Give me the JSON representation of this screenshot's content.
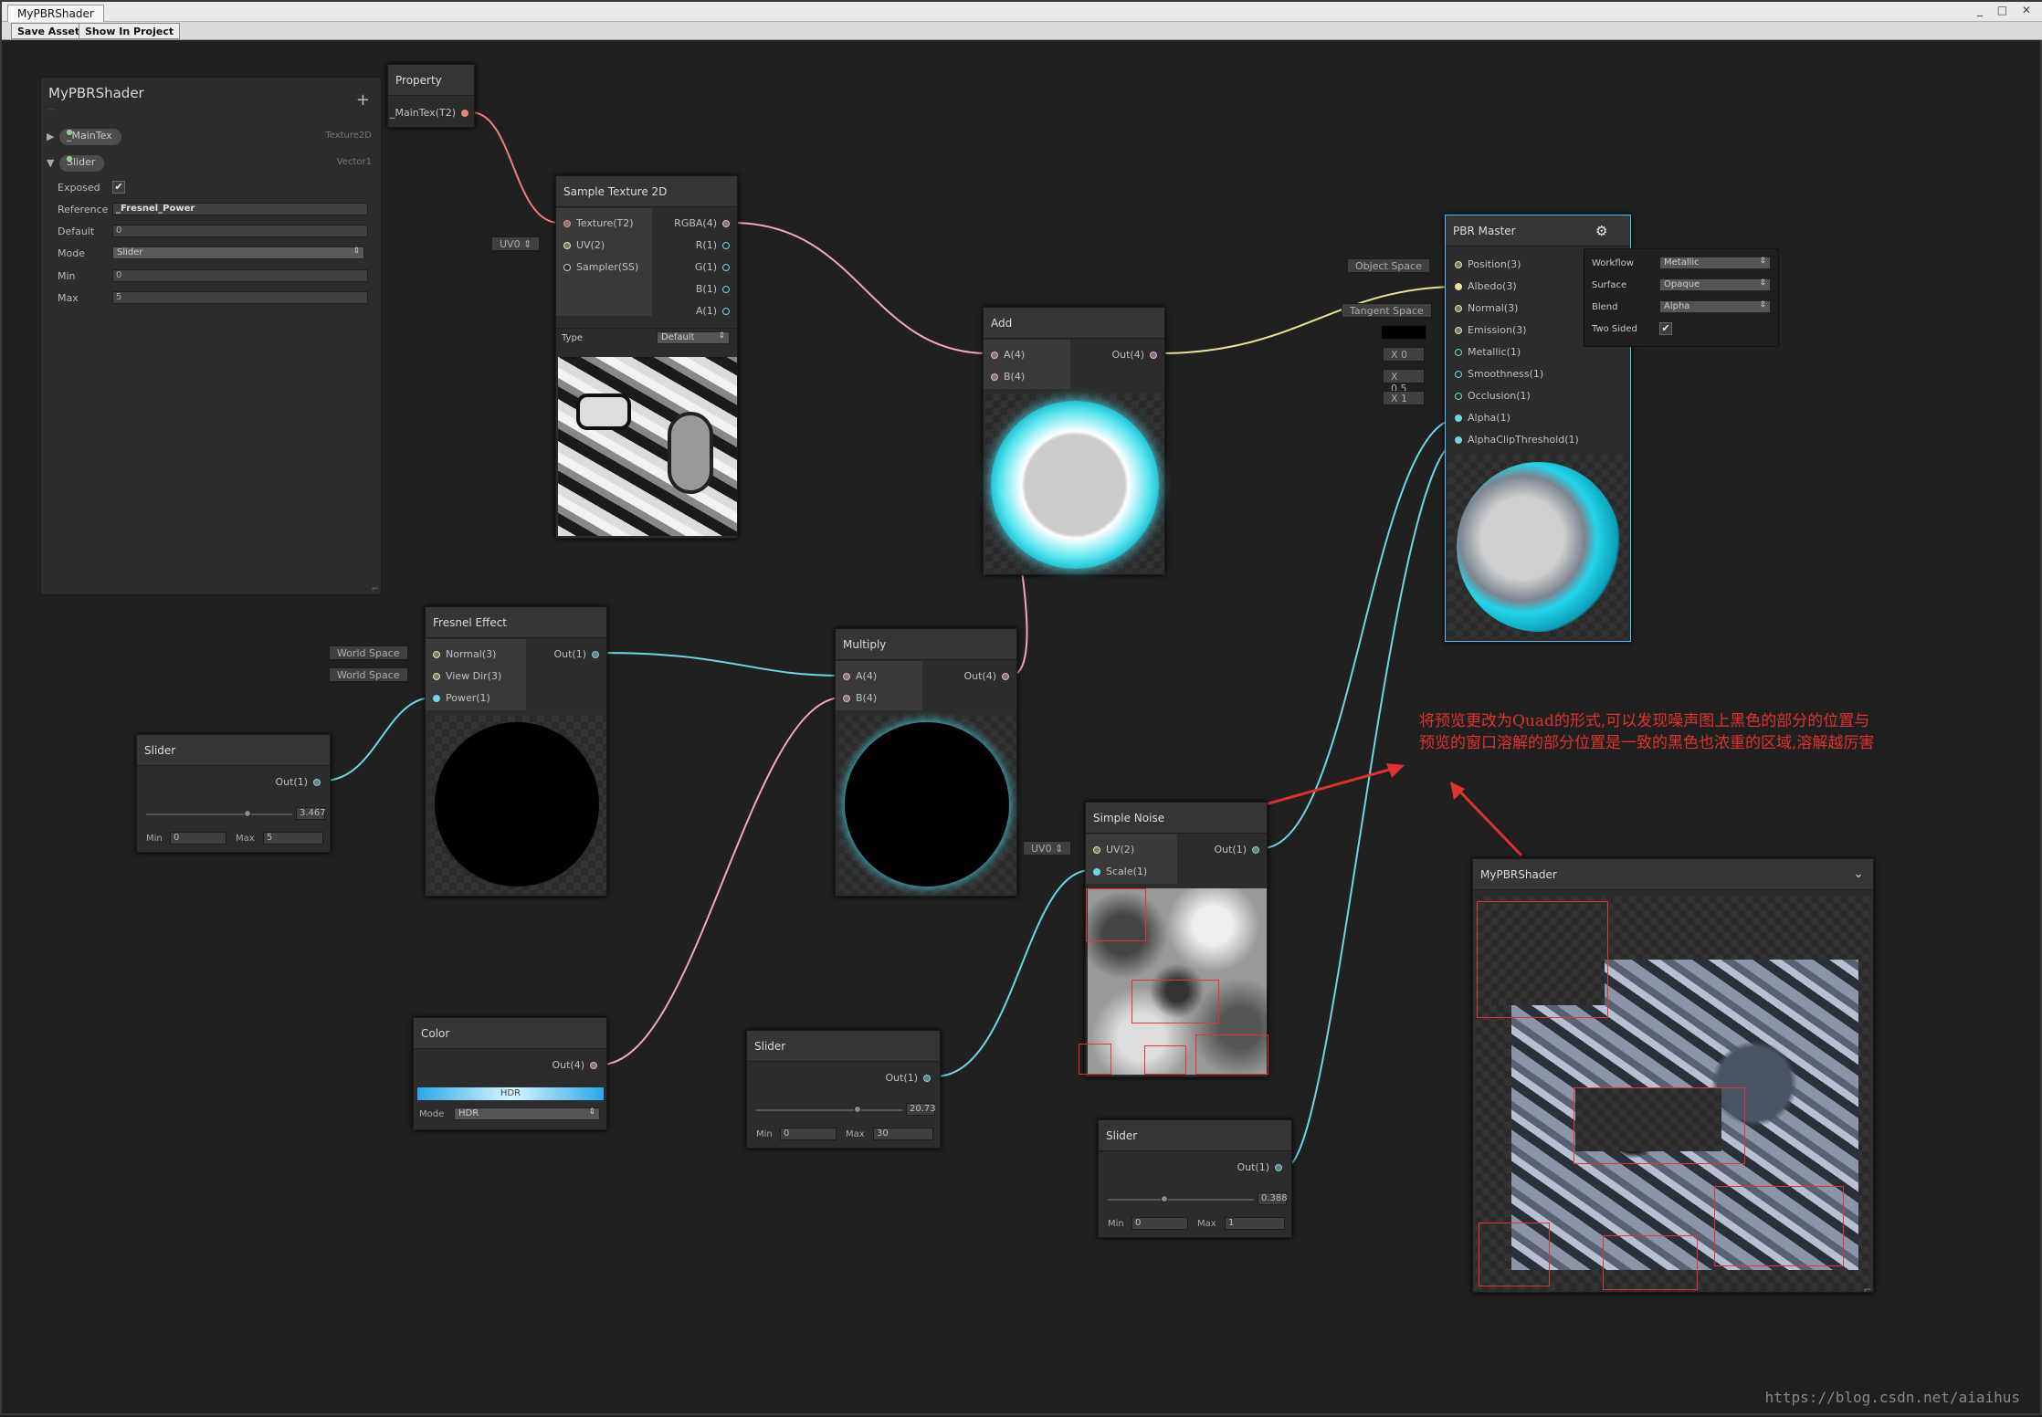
{
  "window": {
    "tab_title": "MyPBRShader",
    "controls": "_ □ ✕"
  },
  "toolbar": {
    "save_label": "Save Asset",
    "show_label": "Show In Project"
  },
  "blackboard": {
    "title": "MyPBRShader",
    "subtitle": "—",
    "add": "+",
    "props": [
      {
        "name": "_MainTex",
        "type": "Texture2D",
        "expanded": false
      },
      {
        "name": "Slider",
        "type": "Vector1",
        "expanded": true
      }
    ],
    "fields": {
      "exposed_label": "Exposed",
      "exposed_check": "✔",
      "reference_label": "Reference",
      "reference_value": "_Fresnel_Power",
      "default_label": "Default",
      "default_value": "0",
      "mode_label": "Mode",
      "mode_value": "Slider",
      "min_label": "Min",
      "min_value": "0",
      "max_label": "Max",
      "max_value": "5"
    },
    "resize": "⌐"
  },
  "nodes": {
    "property": {
      "title": "Property",
      "out": "_MainTex(T2)"
    },
    "sample": {
      "title": "Sample Texture 2D",
      "in": [
        "Texture(T2)",
        "UV(2)",
        "Sampler(SS)"
      ],
      "out": [
        "RGBA(4)",
        "R(1)",
        "G(1)",
        "B(1)",
        "A(1)"
      ],
      "type_label": "Type",
      "type_value": "Default",
      "uv_tag": "UV0 ⇕"
    },
    "add": {
      "title": "Add",
      "in": [
        "A(4)",
        "B(4)"
      ],
      "out": "Out(4)"
    },
    "fresnel": {
      "title": "Fresnel Effect",
      "in": [
        "Normal(3)",
        "View Dir(3)",
        "Power(1)"
      ],
      "out": "Out(1)",
      "tags": [
        "World Space",
        "World Space"
      ]
    },
    "multiply": {
      "title": "Multiply",
      "in": [
        "A(4)",
        "B(4)"
      ],
      "out": "Out(4)"
    },
    "slider1": {
      "title": "Slider",
      "out": "Out(1)",
      "value": "3.467",
      "value_frac": 0.693,
      "min_label": "Min",
      "min": "0",
      "max_label": "Max",
      "max": "5"
    },
    "color": {
      "title": "Color",
      "out": "Out(4)",
      "hdr": "HDR",
      "mode_label": "Mode",
      "mode_value": "HDR"
    },
    "slider2": {
      "title": "Slider",
      "out": "Out(1)",
      "value": "20.73",
      "value_frac": 0.691,
      "min_label": "Min",
      "min": "0",
      "max_label": "Max",
      "max": "30"
    },
    "noise": {
      "title": "Simple Noise",
      "in": [
        "UV(2)",
        "Scale(1)"
      ],
      "out": "Out(1)",
      "uv_tag": "UV0 ⇕"
    },
    "slider3": {
      "title": "Slider",
      "out": "Out(1)",
      "value": "0.388",
      "value_frac": 0.388,
      "min_label": "Min",
      "min": "0",
      "max_label": "Max",
      "max": "1"
    },
    "master": {
      "title": "PBR Master",
      "gear": "⚙",
      "in": [
        "Position(3)",
        "Albedo(3)",
        "Normal(3)",
        "Emission(3)",
        "Metallic(1)",
        "Smoothness(1)",
        "Occlusion(1)",
        "Alpha(1)",
        "AlphaClipThreshold(1)"
      ],
      "tags": {
        "position": "Object Space",
        "normal": "Tangent Space",
        "metallic": "X 0",
        "smoothness": "X 0.5",
        "occlusion": "X 1"
      },
      "settings": [
        {
          "label": "Workflow",
          "value": "Metallic"
        },
        {
          "label": "Surface",
          "value": "Opaque"
        },
        {
          "label": "Blend",
          "value": "Alpha"
        },
        {
          "label": "Two Sided",
          "value": "✔"
        }
      ]
    }
  },
  "preview": {
    "title": "MyPBRShader",
    "menu": "⌄",
    "resize": "⌐"
  },
  "annotation": {
    "line1": "将预览更改为Quad的形式,可以发现噪声图上黑色的部分的位置与",
    "line2": "预览的窗口溶解的部分位置是一致的黑色也浓重的区域,溶解越厉害"
  },
  "watermark": "https://blog.csdn.net/aiaihus",
  "colors": {
    "accent": "#44c0ff",
    "annotation": "#e03030",
    "wire_pink": "#f0a6c8",
    "wire_cyan": "#6cd7e0",
    "wire_yellow": "#e8e29a"
  }
}
